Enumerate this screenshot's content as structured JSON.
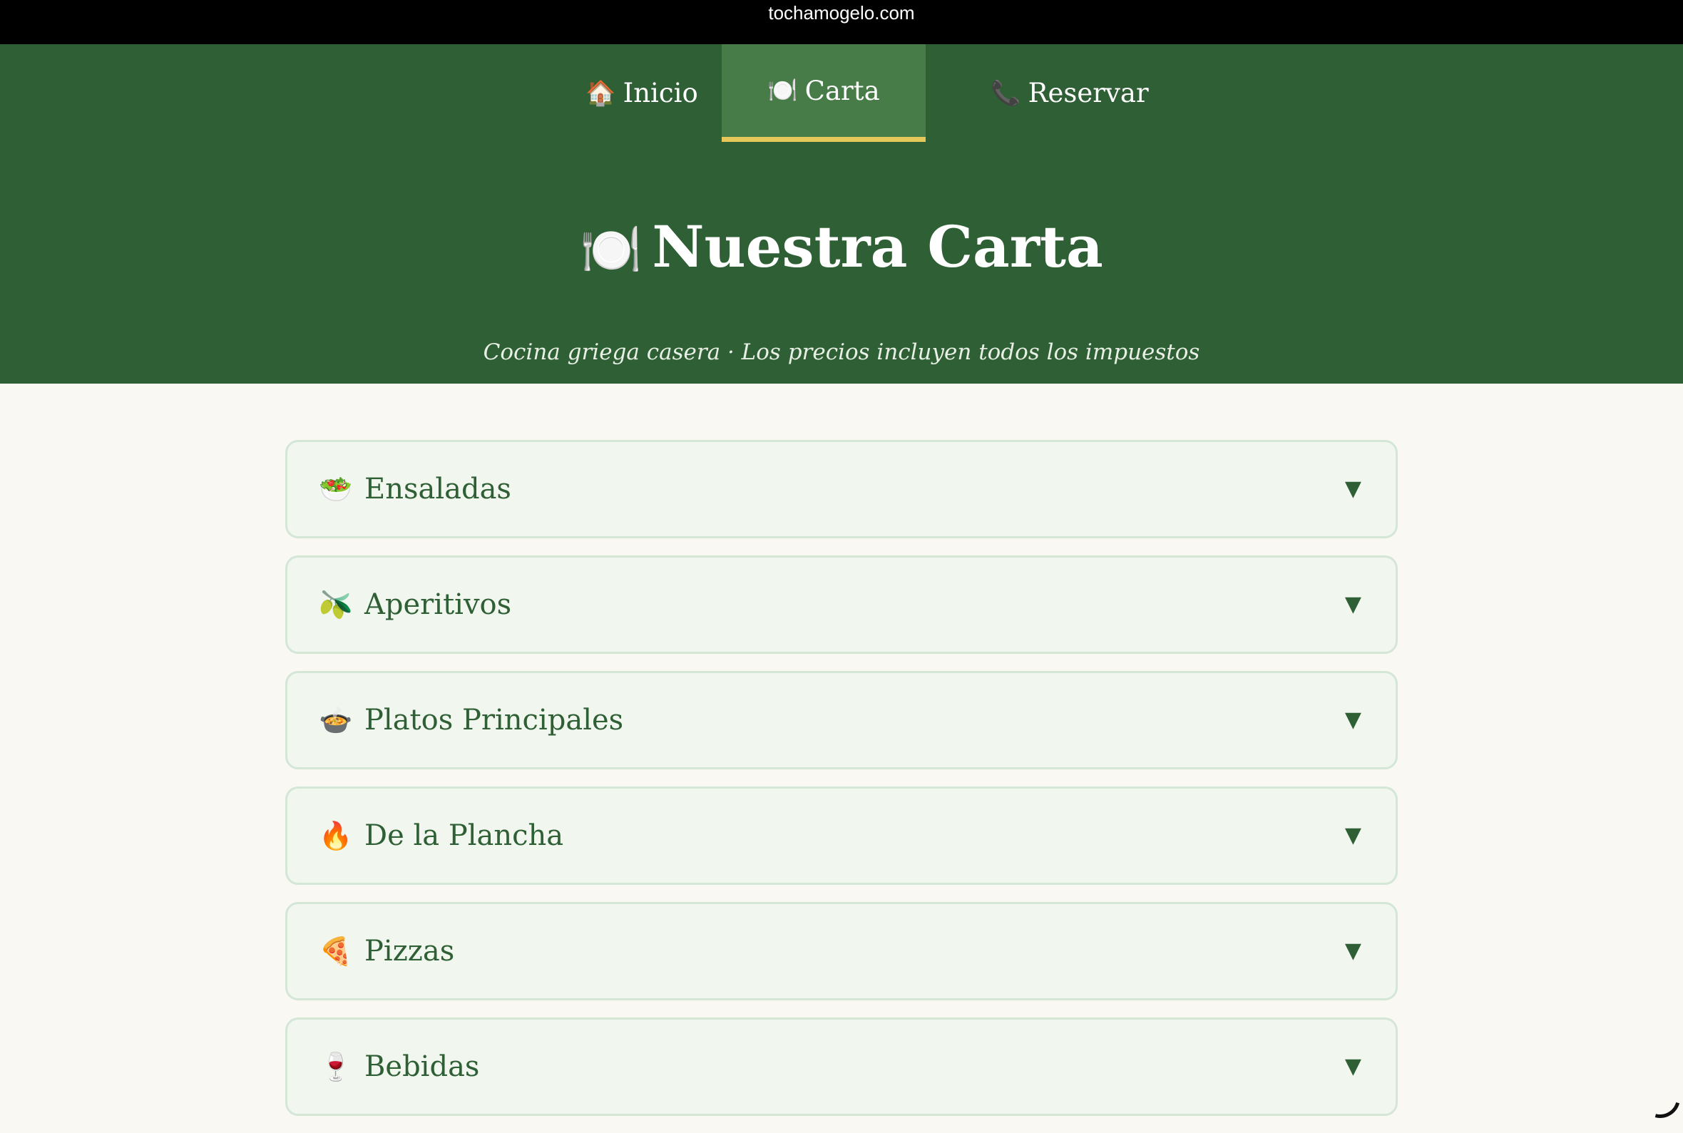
{
  "browser": {
    "url": "tochamogelo.com"
  },
  "nav": {
    "items": [
      {
        "emoji": "🏠",
        "label": "Inicio",
        "icon": "house-icon"
      },
      {
        "emoji": "🍽️",
        "label": "Carta",
        "icon": "plate-icon",
        "active": true
      },
      {
        "emoji": "📞",
        "label": "Reservar",
        "icon": "phone-icon"
      }
    ]
  },
  "hero": {
    "emoji": "🍽️",
    "title": "Nuestra Carta",
    "subtitle": "Cocina griega casera · Los precios incluyen todos los impuestos"
  },
  "menu": {
    "chevron": "▼",
    "categories": [
      {
        "emoji": "🥗",
        "label": "Ensaladas",
        "icon": "salad-icon"
      },
      {
        "emoji": "🫒",
        "label": "Aperitivos",
        "icon": "olive-icon"
      },
      {
        "emoji": "🍲",
        "label": "Platos Principales",
        "icon": "stew-icon"
      },
      {
        "emoji": "🔥",
        "label": "De la Plancha",
        "icon": "fire-icon"
      },
      {
        "emoji": "🍕",
        "label": "Pizzas",
        "icon": "pizza-icon"
      },
      {
        "emoji": "🍷",
        "label": "Bebidas",
        "icon": "wine-icon"
      }
    ]
  },
  "colors": {
    "header_green": "#2f5f34",
    "active_tab": "#477c48",
    "active_underline": "#e6c75a",
    "page_background": "#f9f8f3",
    "card_background": "#f1f6ef",
    "card_border": "#d4e6d6"
  }
}
